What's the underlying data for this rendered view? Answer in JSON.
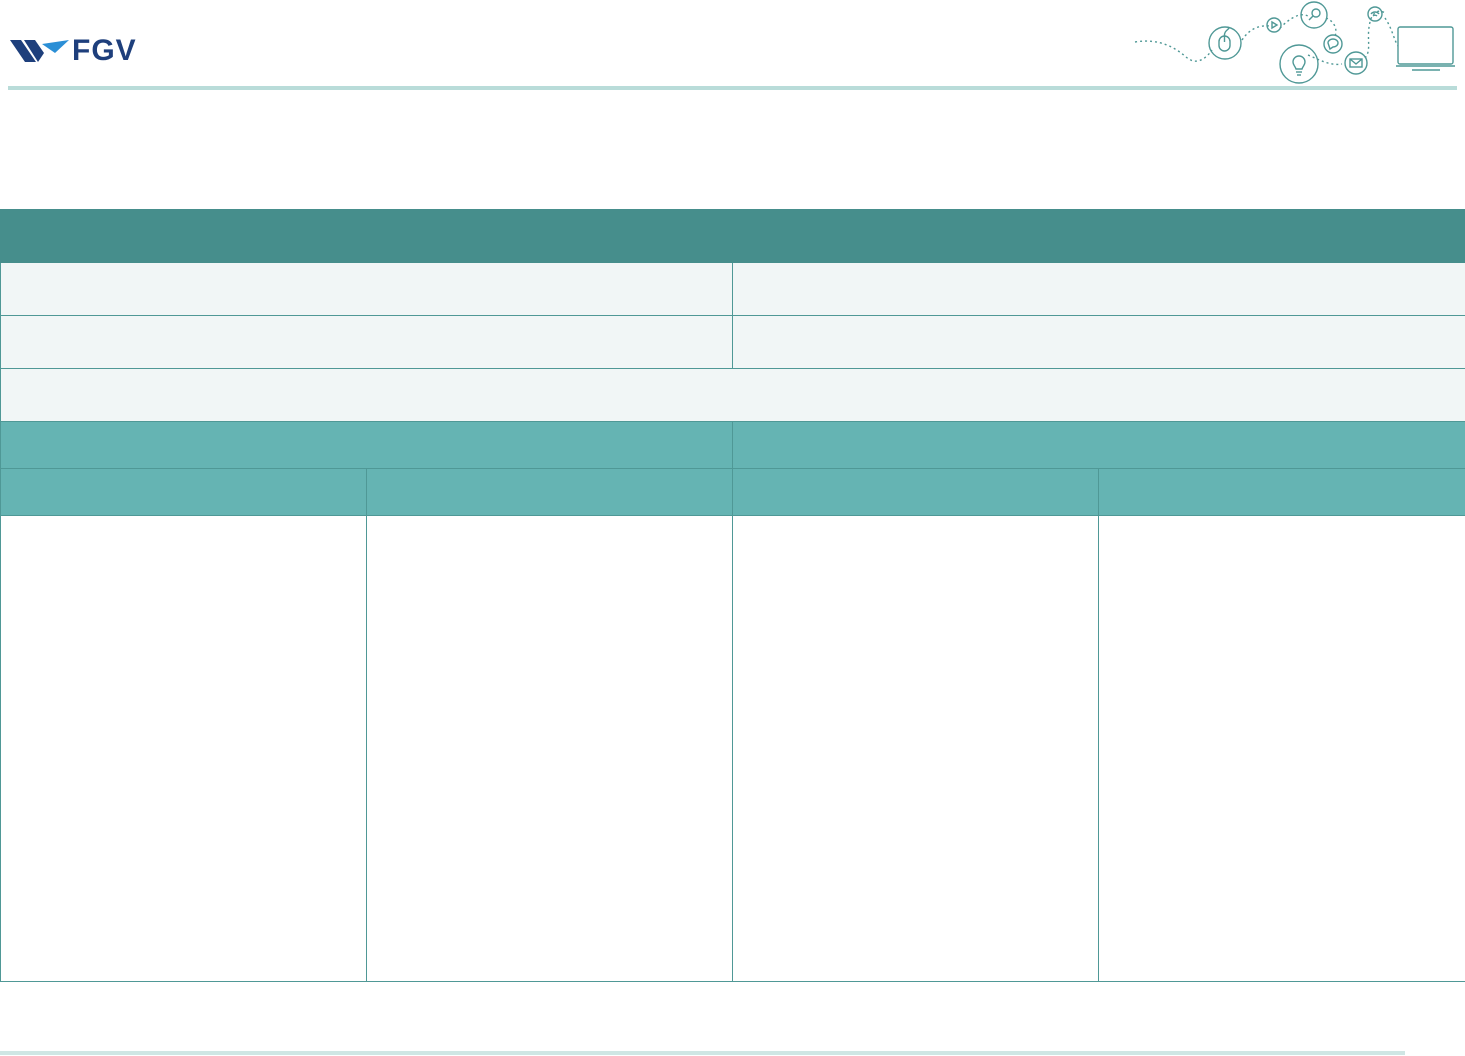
{
  "brand": {
    "logo_text": "FGV",
    "primary_color": "#1e3f7c",
    "accent_color": "#2b8fd6",
    "rule_color": "#b9dcd9"
  },
  "decoration": {
    "icons": [
      "mouse-icon",
      "play-icon",
      "search-icon",
      "chat-icon",
      "lightbulb-icon",
      "mail-icon",
      "wifi-icon",
      "monitor-icon"
    ]
  },
  "table": {
    "colors": {
      "title_bg": "#468e8c",
      "info_bg": "#f1f6f6",
      "section_bg": "#65b4b3",
      "border": "#4f9896"
    },
    "title": "",
    "info_rows": [
      {
        "left": "",
        "right": ""
      },
      {
        "left": "",
        "right": ""
      }
    ],
    "full_row": "",
    "sections": [
      "",
      ""
    ],
    "subheaders": [
      "",
      "",
      "",
      ""
    ],
    "body_cells": [
      "",
      "",
      "",
      ""
    ]
  }
}
